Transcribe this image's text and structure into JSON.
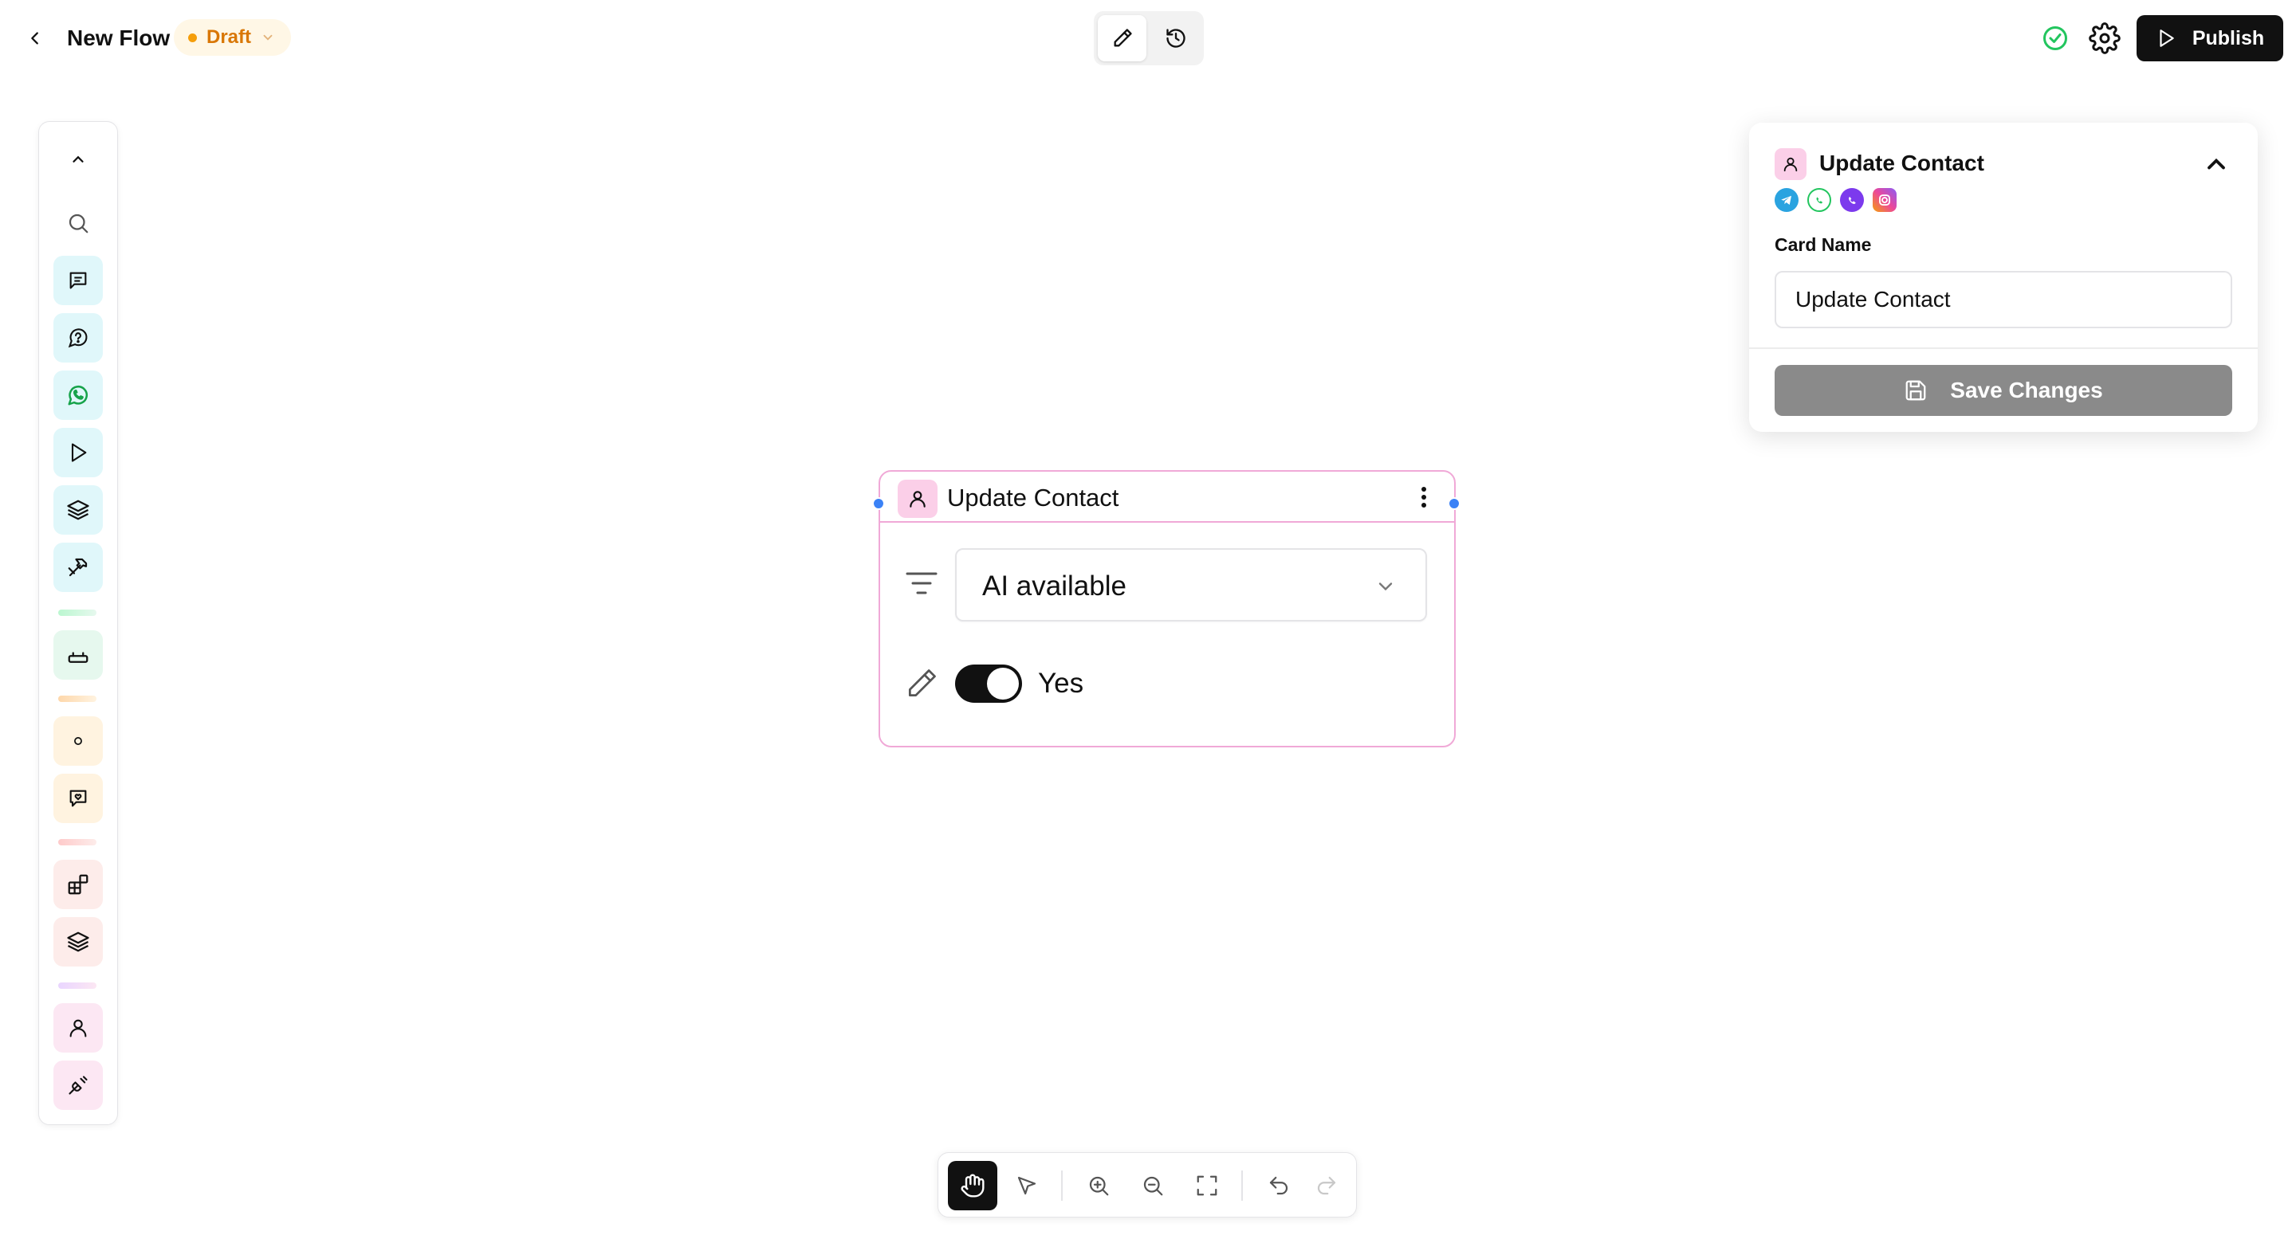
{
  "header": {
    "back_icon": "chevron-left-icon",
    "flow_title": "New Flow",
    "status_badge": "Draft",
    "mode_toggle": [
      "pencil-icon",
      "history-icon"
    ],
    "status_icon": "check-circle-icon",
    "settings_icon": "gear-icon",
    "publish_label": "Publish"
  },
  "sidebar": {
    "items": [
      {
        "icon": "chevron-up-icon"
      },
      {
        "icon": "search-icon"
      },
      {
        "icon": "message-square-icon",
        "color": "#e0f7fa"
      },
      {
        "icon": "message-question-icon",
        "color": "#e0f7fa"
      },
      {
        "icon": "whatsapp-icon",
        "color": "#e0f7fa"
      },
      {
        "icon": "play-icon",
        "color": "#e0f7fa"
      },
      {
        "icon": "layers-icon",
        "color": "#e0f7fa"
      },
      {
        "icon": "hammer-icon",
        "color": "#e0f7fa"
      },
      {
        "icon": "router-icon",
        "color": "#e6f8ee"
      },
      {
        "icon": "dot-icon",
        "color": "#fff3e0"
      },
      {
        "icon": "message-heart-icon",
        "color": "#fff3e0"
      },
      {
        "icon": "blocks-icon",
        "color": "#fdecea"
      },
      {
        "icon": "layers-icon",
        "color": "#fdecea"
      },
      {
        "icon": "user-icon",
        "color": "#fce7f3"
      },
      {
        "icon": "plug-icon",
        "color": "#fce7f3"
      }
    ]
  },
  "node": {
    "title": "Update Contact",
    "icon": "user-icon",
    "menu_icon": "more-vertical-icon",
    "field_select_value": "AI available",
    "filter_icon": "filter-icon",
    "edit_icon": "pencil-icon",
    "toggle_on": true,
    "toggle_label": "Yes"
  },
  "panel": {
    "title": "Update Contact",
    "channels": [
      "telegram-icon",
      "whatsapp-icon",
      "viber-icon",
      "instagram-icon"
    ],
    "card_name_label": "Card Name",
    "card_name_value": "Update Contact",
    "save_label": "Save Changes"
  },
  "toolbar": {
    "tools": [
      "hand-icon",
      "pointer-icon",
      "zoom-in-icon",
      "zoom-out-icon",
      "fit-view-icon",
      "undo-icon",
      "redo-icon"
    ],
    "active_tool": "hand-icon"
  },
  "colors": {
    "accent_dark": "#111111",
    "draft": "#d97706",
    "node_border": "#f0a9d7",
    "handle": "#3b82f6",
    "save_disabled": "#8a8a8a"
  }
}
